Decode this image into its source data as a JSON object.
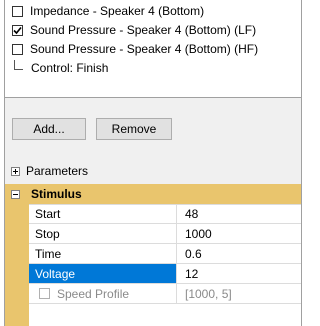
{
  "measurements": {
    "items": [
      {
        "label": "Impedance - Speaker 4 (Bottom)",
        "checked": false
      },
      {
        "label": "Sound Pressure - Speaker 4 (Bottom) (LF)",
        "checked": true
      },
      {
        "label": "Sound Pressure - Speaker 4 (Bottom) (HF)",
        "checked": false
      }
    ],
    "control_label": "Control: Finish"
  },
  "buttons": {
    "add_label": "Add...",
    "remove_label": "Remove"
  },
  "parameters": {
    "header_label": "Parameters",
    "category": "Stimulus",
    "rows": [
      {
        "name": "Start",
        "value": "48"
      },
      {
        "name": "Stop",
        "value": "1000"
      },
      {
        "name": "Time",
        "value": "0.6"
      },
      {
        "name": "Voltage",
        "value": "12"
      },
      {
        "name": "Speed Profile",
        "value": "[1000, 5]"
      }
    ],
    "selected_row": "Voltage"
  },
  "colors": {
    "category_bg": "#e9c56d",
    "selection": "#0078d7"
  }
}
